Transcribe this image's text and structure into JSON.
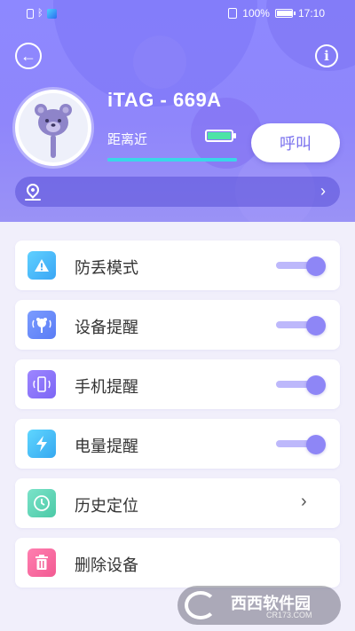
{
  "status_bar": {
    "battery": "100%",
    "time": "17:10",
    "battery_level": 1.0
  },
  "device": {
    "name": "iTAG - 669A",
    "distance": "距离近",
    "battery_level": 1.0,
    "signal_level": 1.0,
    "call_label": "呼叫"
  },
  "location": {
    "address": ""
  },
  "settings": [
    {
      "label": "防丢模式",
      "icon": "warning-icon",
      "type": "toggle",
      "on": true
    },
    {
      "label": "设备提醒",
      "icon": "device-alert-icon",
      "type": "toggle",
      "on": true
    },
    {
      "label": "手机提醒",
      "icon": "phone-alert-icon",
      "type": "toggle",
      "on": true
    },
    {
      "label": "电量提醒",
      "icon": "lightning-icon",
      "type": "toggle",
      "on": true
    },
    {
      "label": "历史定位",
      "icon": "clock-icon",
      "type": "link"
    },
    {
      "label": "删除设备",
      "icon": "trash-icon",
      "type": "action"
    }
  ],
  "watermark": {
    "text": "西西软件园",
    "sub": "CR173.COM"
  },
  "colors": {
    "accent": "#8e86f6",
    "header": "#8d88ff"
  }
}
